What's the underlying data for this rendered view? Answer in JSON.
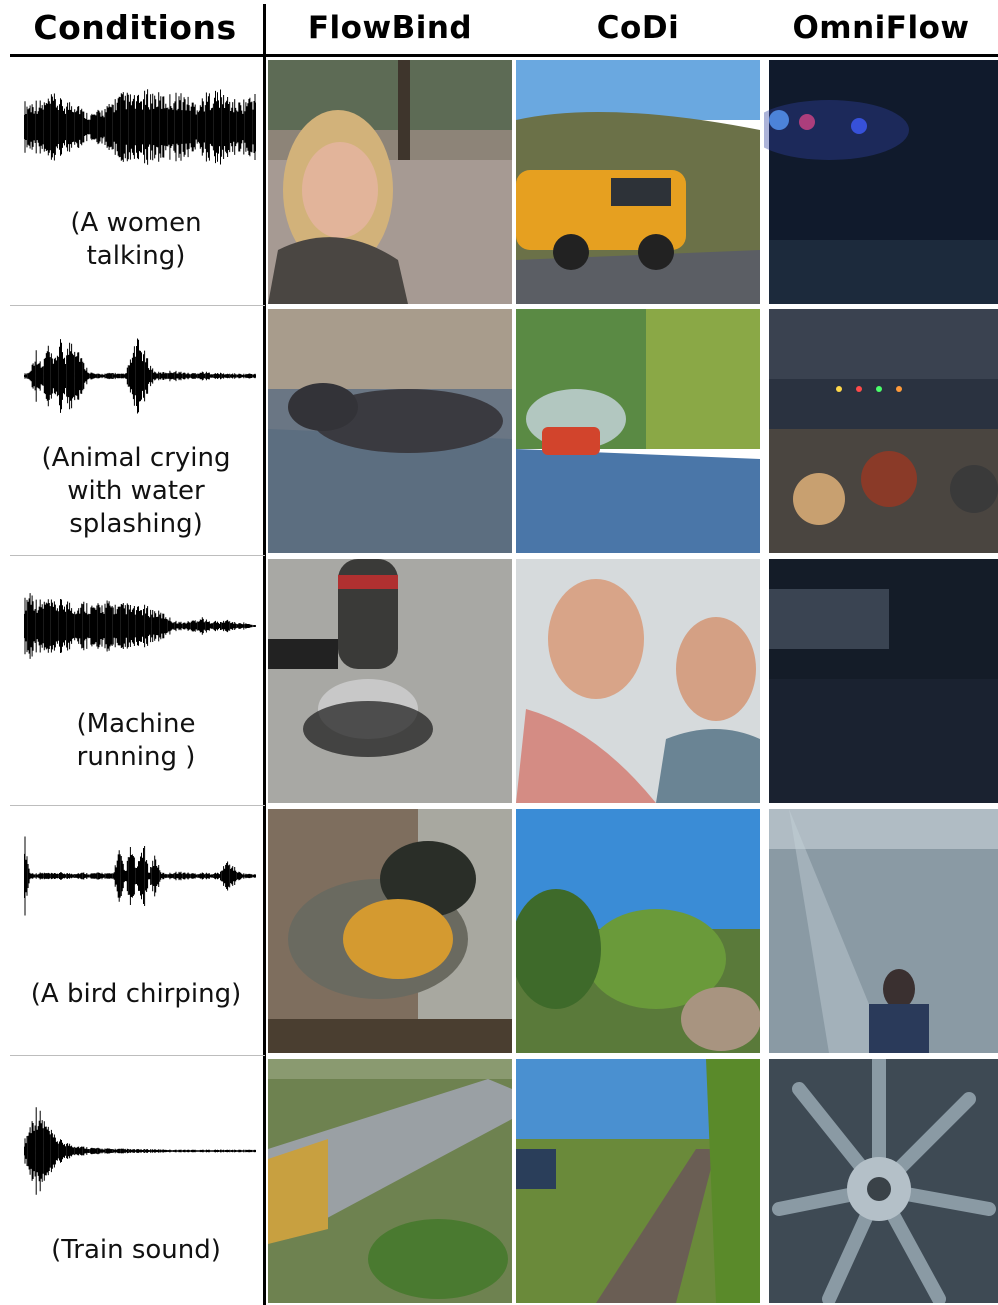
{
  "header": {
    "conditions": "Conditions",
    "col_flowbind": "FlowBind",
    "col_codi": "CoDi",
    "col_omniflow": "OmniFlow"
  },
  "rows": [
    {
      "caption": "(A women\ntalking)",
      "wave": [
        0.55,
        0.55,
        0.6,
        0.55,
        0.62,
        0.7,
        0.6,
        0.55,
        0.58,
        0.6,
        0.35,
        0.3,
        0.32,
        0.4,
        0.45,
        0.6,
        0.7,
        0.75,
        0.7,
        0.65,
        0.72,
        0.8,
        0.75,
        0.7,
        0.68,
        0.72,
        0.75,
        0.7,
        0.6,
        0.55,
        0.65,
        0.75,
        0.8,
        0.78,
        0.7,
        0.6,
        0.55,
        0.6,
        0.7,
        0.75
      ]
    },
    {
      "caption": "(Animal crying\nwith water\nsplashing)",
      "wave": [
        0.05,
        0.1,
        0.6,
        0.2,
        0.7,
        0.3,
        0.8,
        0.5,
        0.9,
        0.7,
        0.3,
        0.1,
        0.05,
        0.05,
        0.06,
        0.08,
        0.05,
        0.05,
        0.4,
        0.8,
        0.6,
        0.3,
        0.1,
        0.08,
        0.1,
        0.12,
        0.1,
        0.08,
        0.06,
        0.08,
        0.1,
        0.08,
        0.06,
        0.07,
        0.05,
        0.06,
        0.05,
        0.05,
        0.06,
        0.05
      ]
    },
    {
      "caption": "(Machine\nrunning )",
      "wave": [
        0.55,
        0.85,
        0.6,
        0.55,
        0.6,
        0.5,
        0.55,
        0.6,
        0.5,
        0.45,
        0.55,
        0.5,
        0.45,
        0.5,
        0.55,
        0.5,
        0.45,
        0.5,
        0.45,
        0.4,
        0.45,
        0.4,
        0.35,
        0.3,
        0.25,
        0.12,
        0.1,
        0.08,
        0.12,
        0.15,
        0.2,
        0.1,
        0.12,
        0.08,
        0.15,
        0.1,
        0.06,
        0.08,
        0.04,
        0.02
      ]
    },
    {
      "caption": "(A bird chirping)",
      "wave": [
        1.0,
        0.08,
        0.06,
        0.08,
        0.07,
        0.06,
        0.08,
        0.07,
        0.06,
        0.07,
        0.08,
        0.06,
        0.07,
        0.08,
        0.06,
        0.07,
        0.6,
        0.1,
        0.7,
        0.15,
        0.8,
        0.1,
        0.5,
        0.08,
        0.06,
        0.08,
        0.1,
        0.08,
        0.07,
        0.06,
        0.08,
        0.06,
        0.07,
        0.08,
        0.35,
        0.25,
        0.1,
        0.06,
        0.05,
        0.04
      ]
    },
    {
      "caption": "(Train sound)",
      "wave": [
        0.2,
        0.6,
        1.0,
        0.8,
        0.55,
        0.35,
        0.25,
        0.2,
        0.15,
        0.12,
        0.1,
        0.08,
        0.07,
        0.06,
        0.06,
        0.05,
        0.05,
        0.05,
        0.04,
        0.04,
        0.04,
        0.04,
        0.04,
        0.035,
        0.035,
        0.03,
        0.03,
        0.03,
        0.03,
        0.03,
        0.03,
        0.03,
        0.03,
        0.03,
        0.03,
        0.03,
        0.03,
        0.03,
        0.03,
        0.03
      ]
    }
  ]
}
